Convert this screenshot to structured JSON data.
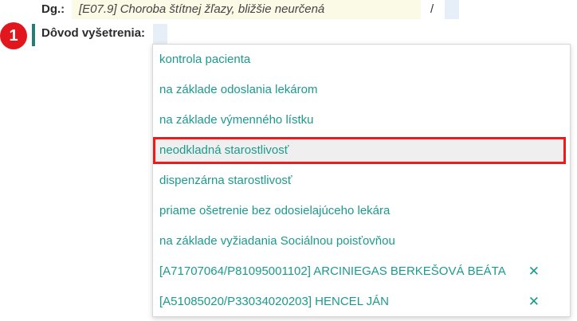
{
  "diagnosis": {
    "label": "Dg.:",
    "value": "[E07.9] Choroba štítnej žľazy, bližšie neurčená",
    "separator": "/"
  },
  "reason": {
    "step_number": "1",
    "label": "Dôvod vyšetrenia:"
  },
  "dropdown": {
    "options": [
      {
        "label": "kontrola pacienta"
      },
      {
        "label": "na základe odoslania lekárom"
      },
      {
        "label": "na základe výmenného lístku"
      },
      {
        "label": "neodkladná starostlivosť",
        "selected": true
      },
      {
        "label": "dispenzárna starostlivosť"
      },
      {
        "label": "priame ošetrenie bez odosielajúceho lekára"
      },
      {
        "label": "na základe vyžiadania Sociálnou poisťovňou"
      },
      {
        "label": "[A71707064/P81095001102] ARCINIEGAS BERKEŠOVÁ BEÁTA",
        "removable": true,
        "remove_glyph": "✕"
      },
      {
        "label": "[A51085020/P33034020203] HENCEL JÁN",
        "removable": true,
        "remove_glyph": "✕"
      }
    ]
  },
  "colors": {
    "accent_teal": "#1b9a8e",
    "badge_red": "#e2171d",
    "highlight_border": "#ee1b1b",
    "field_bg": "#fbfae6"
  }
}
